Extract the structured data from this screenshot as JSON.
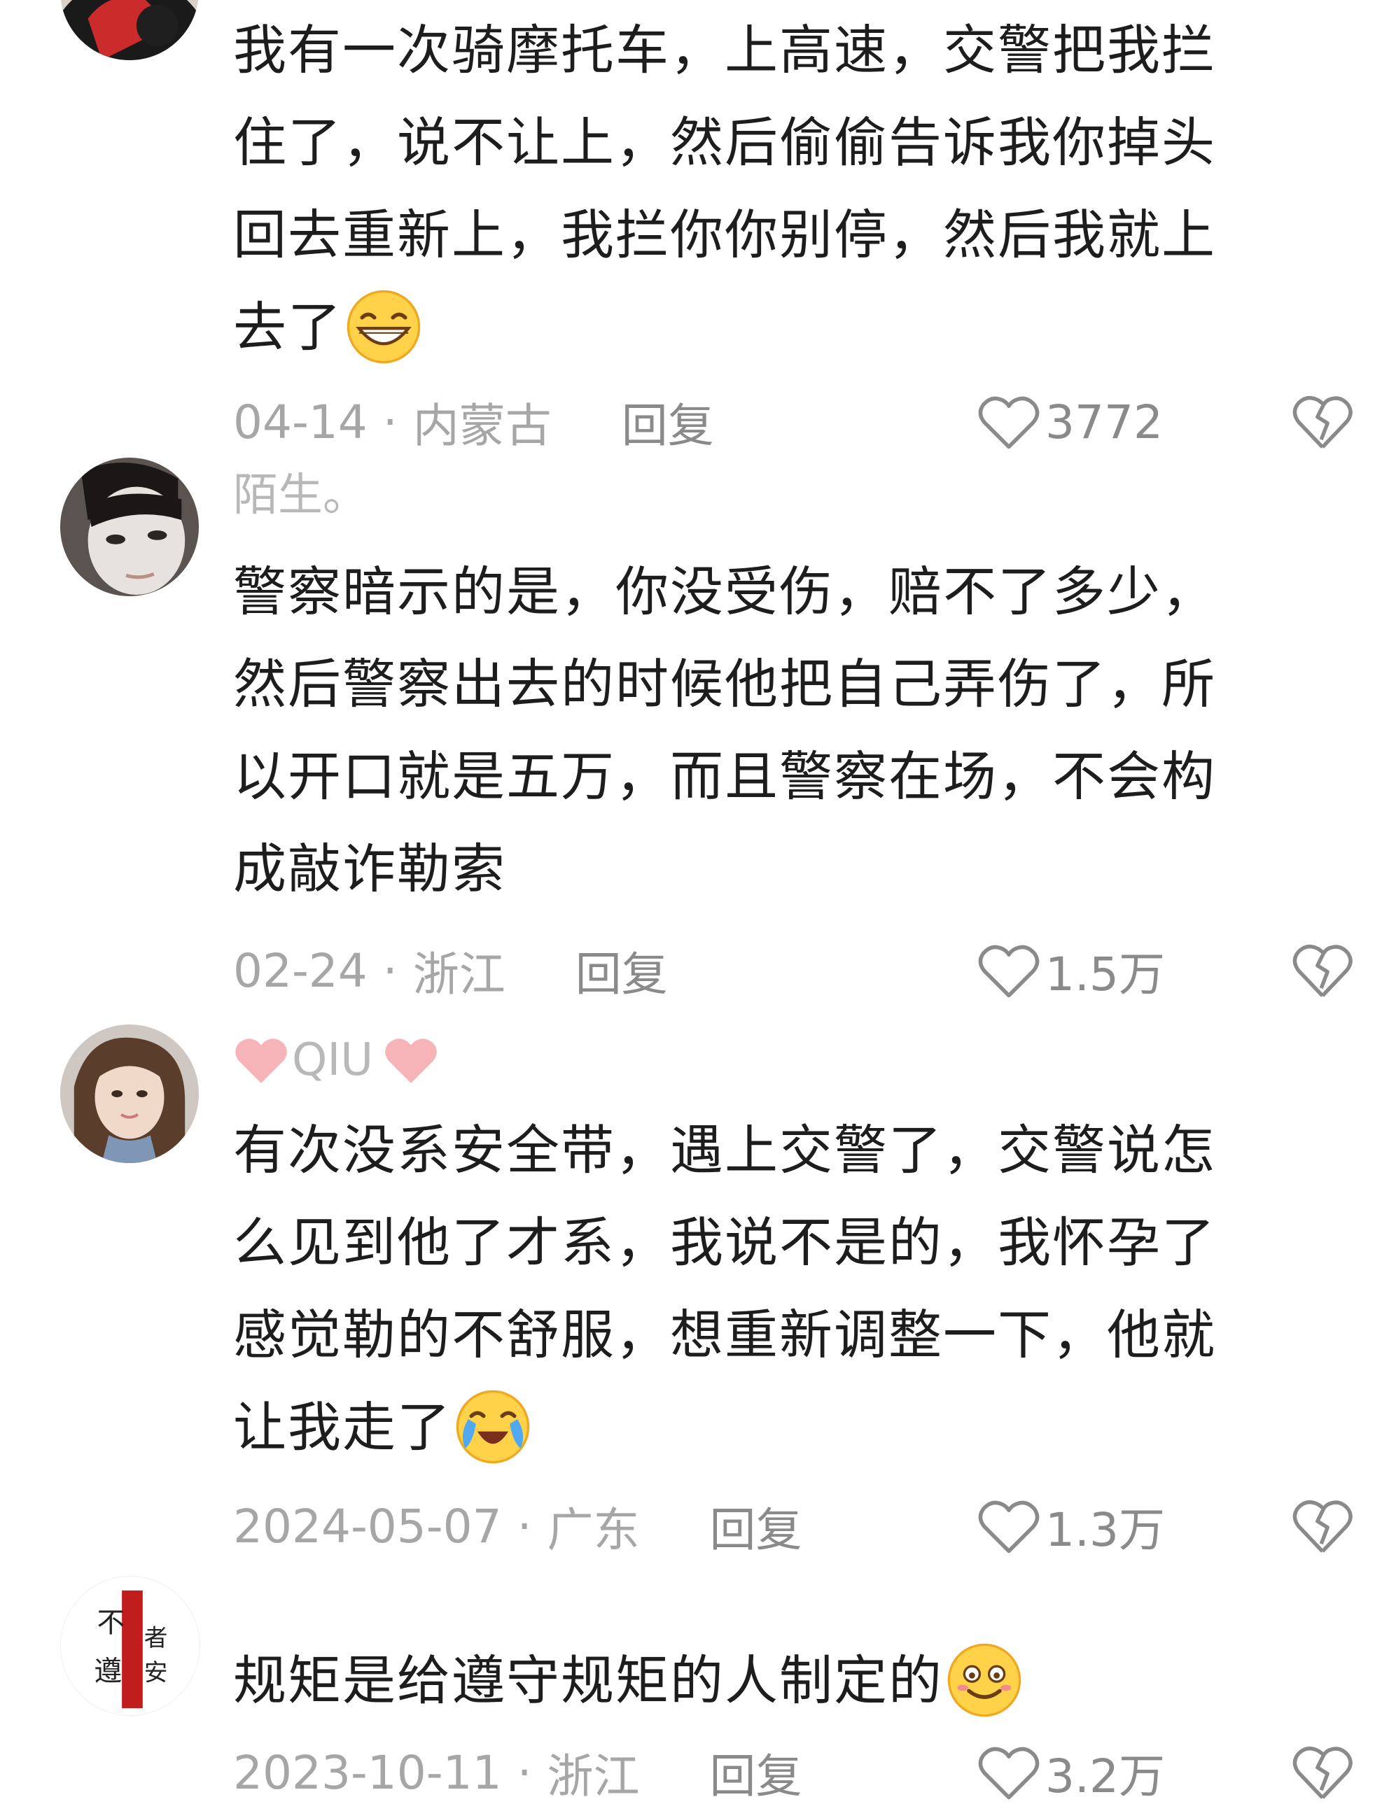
{
  "comments": [
    {
      "username": "",
      "lines": [
        "我有一次骑摩托车，上高速，交警把我拦",
        "住了，说不让上，然后偷偷告诉我你掉头",
        "回去重新上，我拦你你别停，然后我就上",
        "去了"
      ],
      "emoji": "grin-emoji",
      "date": "04-14",
      "region": "内蒙古",
      "reply_label": "回复",
      "likes": "3772"
    },
    {
      "username": "陌生。",
      "lines": [
        "警察暗示的是，你没受伤，赔不了多少，",
        "然后警察出去的时候他把自己弄伤了，所",
        "以开口就是五万，而且警察在场，不会构",
        "成敲诈勒索"
      ],
      "date": "02-24",
      "region": "浙江",
      "reply_label": "回复",
      "likes": "1.5万"
    },
    {
      "username": "QIU",
      "lines": [
        "有次没系安全带，遇上交警了，交警说怎",
        "么见到他了才系，我说不是的，我怀孕了",
        "感觉勒的不舒服，想重新调整一下，他就",
        "让我走了"
      ],
      "emoji": "crying-laugh-emoji",
      "date": "2024-05-07",
      "region": "广东",
      "reply_label": "回复",
      "likes": "1.3万"
    },
    {
      "username": "",
      "lines": [
        "规矩是给遵守规矩的人制定的"
      ],
      "emoji": "smile-emoji",
      "date": "2023-10-11",
      "region": "浙江",
      "reply_label": "回复",
      "likes": "3.2万"
    }
  ],
  "separator": "·",
  "colors": {
    "meta": "#a6a6a6",
    "text": "#1d1d1d",
    "username": "#b8b8b8",
    "pink_heart": "#f6b3b8"
  }
}
